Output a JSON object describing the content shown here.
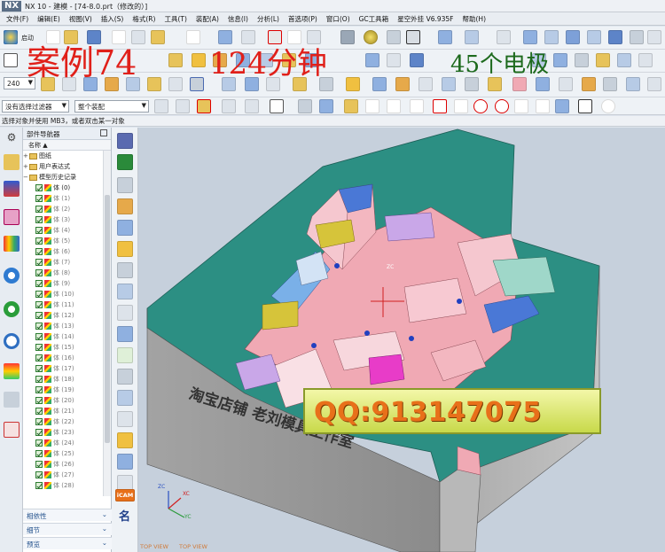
{
  "window": {
    "logo": "NX",
    "title": "NX 10 - 建模 - [74-8.0.prt（修改的）]"
  },
  "menu": [
    "文件(F)",
    "编辑(E)",
    "视图(V)",
    "插入(S)",
    "格式(R)",
    "工具(T)",
    "装配(A)",
    "信息(I)",
    "分析(L)",
    "首选项(P)",
    "窗口(O)",
    "GC工具箱",
    "星空外挂 V6.935F",
    "帮助(H)"
  ],
  "toolbar": {
    "start_label": "启动",
    "zoom_value": "240"
  },
  "overlay": {
    "title": "案例74",
    "duration": "124分钟",
    "electrodes": "45个电极"
  },
  "filter": {
    "selection_filter": "没有选择过滤器",
    "assembly_scope": "整个装配"
  },
  "status": "选择对象并使用 MB3，或者双击某一对象",
  "navigator": {
    "title": "部件导航器",
    "column_name": "名称",
    "tree": [
      {
        "label": "图纸",
        "kind": "folder",
        "level": 0
      },
      {
        "label": "用户表达式",
        "kind": "folder",
        "level": 0
      },
      {
        "label": "模型历史记录",
        "kind": "folder",
        "level": 0
      }
    ],
    "bodies": [
      "体 (0)",
      "体 (1)",
      "体 (2)",
      "体 (3)",
      "体 (4)",
      "体 (5)",
      "体 (6)",
      "体 (7)",
      "体 (8)",
      "体 (9)",
      "体 (10)",
      "体 (11)",
      "体 (12)",
      "体 (13)",
      "体 (14)",
      "体 (15)",
      "体 (16)",
      "体 (17)",
      "体 (18)",
      "体 (19)",
      "体 (20)",
      "体 (21)",
      "体 (22)",
      "体 (23)",
      "体 (24)",
      "体 (25)",
      "体 (26)",
      "体 (27)",
      "体 (28)"
    ],
    "sections": [
      "相依性",
      "细节",
      "预览"
    ]
  },
  "vtoolbar": {
    "icam_label": "iCAM",
    "name_label": "名"
  },
  "viewport": {
    "shop_text": "淘宝店铺  老刘模具工作室",
    "qq_text": "QQ:913147075",
    "view_labels": [
      "TOP VIEW",
      "TOP VIEW"
    ],
    "axis_labels": [
      "ZC",
      "XC",
      "YC"
    ]
  },
  "colors": {
    "plate_top": "#2c8f83",
    "plate_side": "#9b9b9b",
    "cavity_pink": "#f0a9b4",
    "cavity_blue": "#5a7fd6",
    "accent_yellow": "#d6c43a"
  }
}
